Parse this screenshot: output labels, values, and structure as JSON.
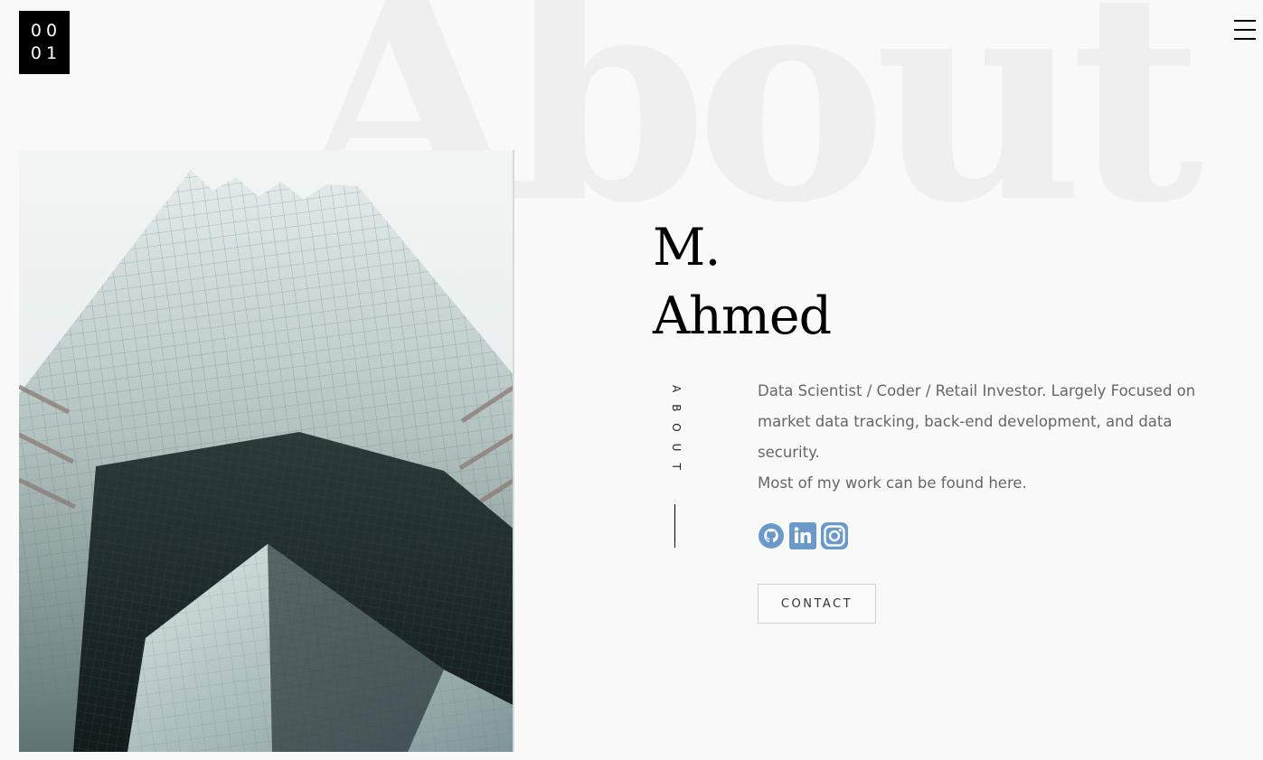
{
  "logo": {
    "line1": "00",
    "line2": "01"
  },
  "background_title": "About",
  "name": {
    "line1": "M.",
    "line2": "Ahmed"
  },
  "side_label": "ABOUT",
  "bio": {
    "paragraph1": "Data Scientist / Coder / Retail Investor. Largely Focused on market data tracking, back-end development, and data security.",
    "paragraph2": "Most of my work can be found here."
  },
  "socials": [
    {
      "icon": "github-icon"
    },
    {
      "icon": "linkedin-icon"
    },
    {
      "icon": "instagram-icon"
    }
  ],
  "contact_label": "CONTACT",
  "colors": {
    "accent": "#6b99c9",
    "text": "#666666",
    "heading": "#000000",
    "background": "#f9f9f9"
  }
}
